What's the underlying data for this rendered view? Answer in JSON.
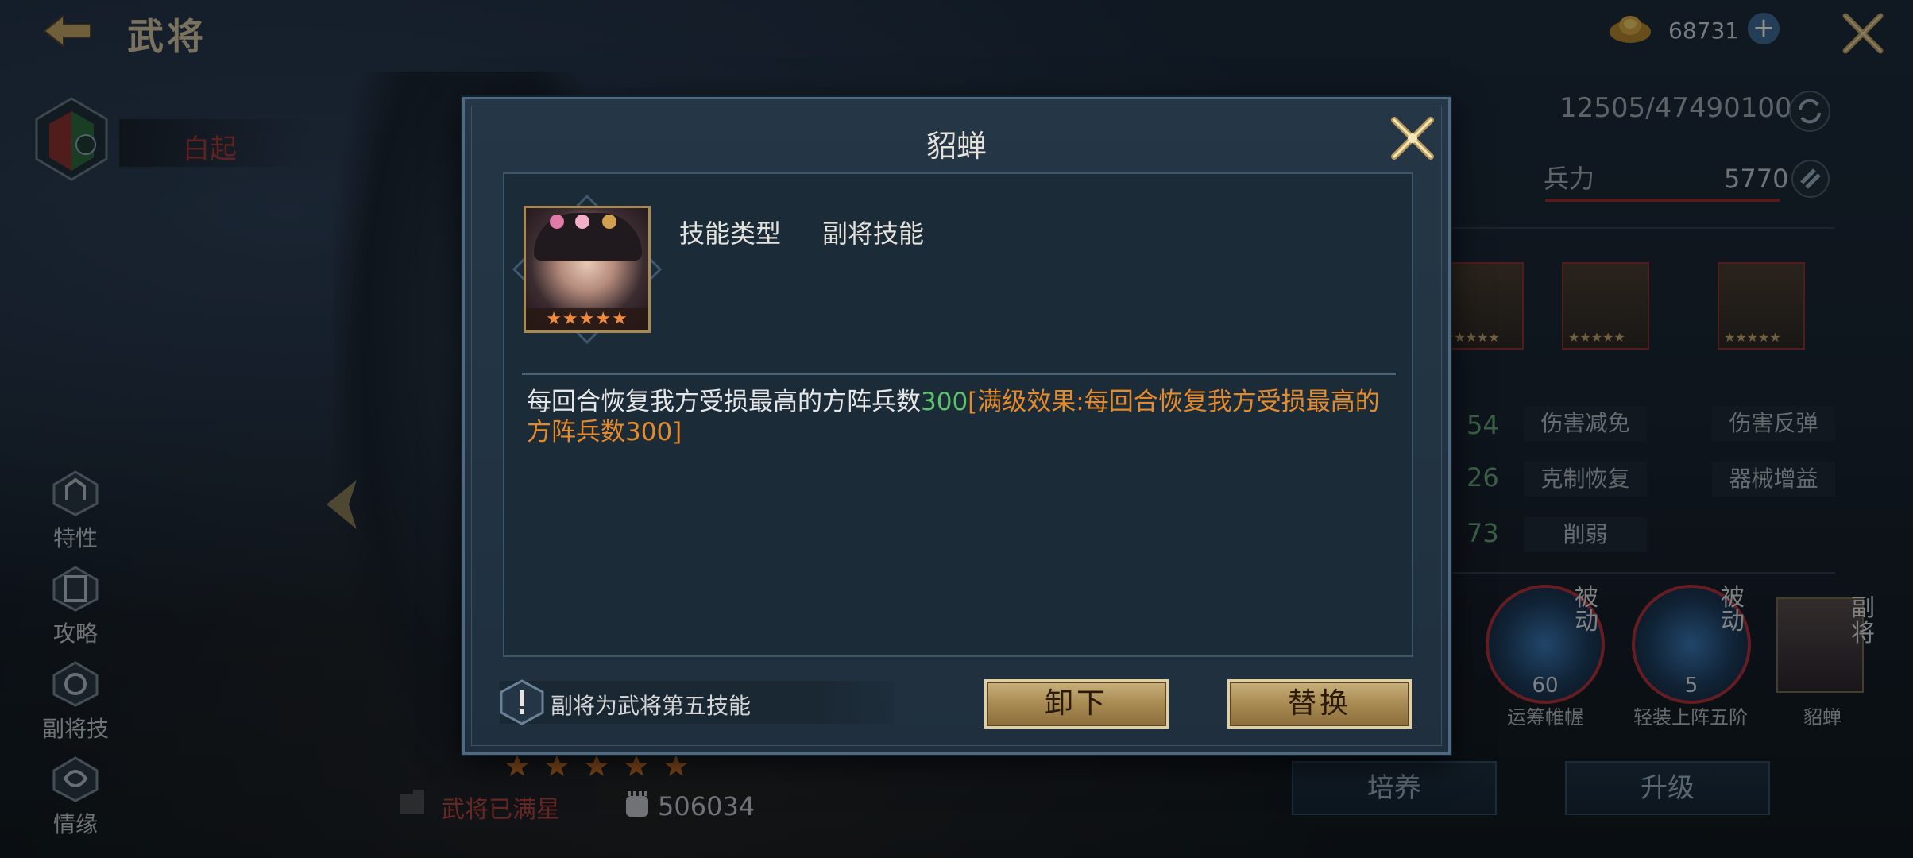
{
  "header": {
    "title": "武将",
    "gold_value": "68731"
  },
  "hero": {
    "name": "白起",
    "max_star_text": "武将已满星",
    "power_value": "506034"
  },
  "side_menu": [
    {
      "label": "特性",
      "icon": "trait-icon"
    },
    {
      "label": "攻略",
      "icon": "book-icon"
    },
    {
      "label": "副将技",
      "icon": "deputy-skill-icon"
    },
    {
      "label": "情缘",
      "icon": "bond-icon"
    }
  ],
  "right_panel": {
    "exp_value": "12505/47490100",
    "troop_label": "兵力",
    "troop_value": "5770",
    "stat_nums": [
      "54",
      "26",
      "73"
    ],
    "stat_tags": [
      "伤害减免",
      "伤害反弹",
      "克制恢复",
      "器械增益",
      "削弱"
    ],
    "skills": [
      {
        "name": "运筹帷幄",
        "level": "60",
        "tag": "被动"
      },
      {
        "name": "轻装上阵五阶",
        "level": "5",
        "tag": "被动"
      }
    ],
    "sub_general": {
      "name": "貂蝉",
      "tag": "副将"
    },
    "buttons": {
      "train": "培养",
      "upgrade": "升级"
    }
  },
  "dialog": {
    "title": "貂蝉",
    "skill_type_label": "技能类型",
    "skill_type_value": "副将技能",
    "desc_main": "每回合恢复我方受损最高的方阵兵数",
    "desc_value": "300",
    "desc_full_effect": "[满级效果:每回合恢复我方受损最高的方阵兵数300]",
    "hint": "副将为武将第五技能",
    "unload_button": "卸下",
    "replace_button": "替换",
    "portrait_stars": "★★★★★"
  },
  "colors": {
    "accent_gold": "#c9b27e",
    "value_green": "#5dc26a",
    "effect_orange": "#e58a2a",
    "hero_name_red": "#a83a33"
  }
}
